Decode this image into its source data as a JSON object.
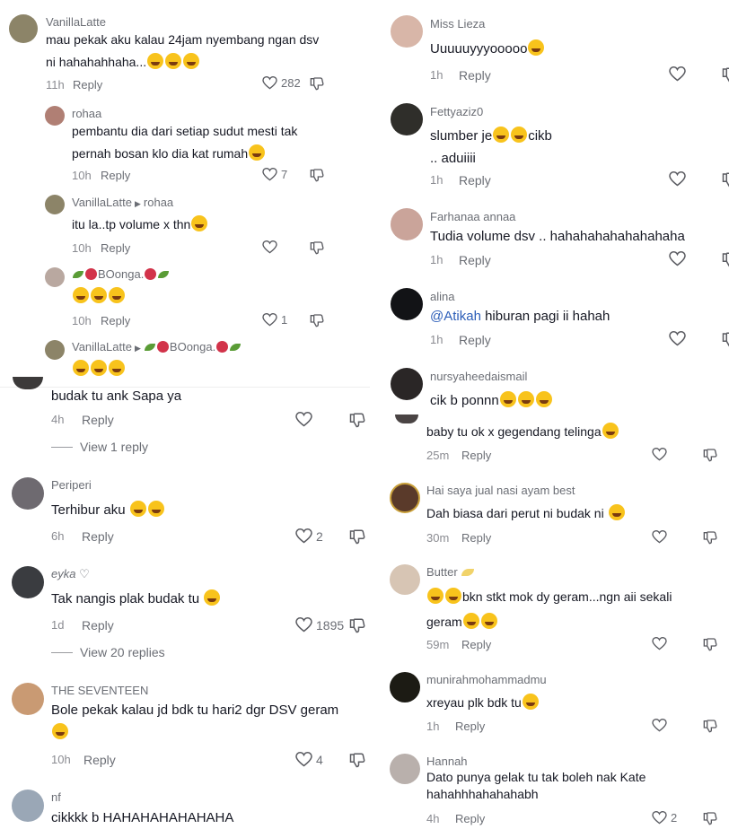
{
  "left": {
    "c1": {
      "name": "VanillaLatte",
      "line1": "mau pekak aku kalau 24jam nyembang ngan dsv",
      "line2": "ni hahahahhaha...",
      "time": "11h",
      "reply": "Reply",
      "likes": "282"
    },
    "c2": {
      "name": "rohaa",
      "line1": "pembantu dia dari setiap sudut mesti tak",
      "line2": "pernah bosan klo dia kat rumah",
      "time": "10h",
      "reply": "Reply",
      "likes": "7"
    },
    "c3": {
      "name": "VanillaLatte",
      "to": "rohaa",
      "line1": "itu la..tp volume x thn",
      "time": "10h",
      "reply": "Reply"
    },
    "c4": {
      "name": "BOonga.",
      "time": "10h",
      "reply": "Reply",
      "likes": "1"
    },
    "c5": {
      "name": "VanillaLatte",
      "to": "BOonga."
    },
    "c6": {
      "line1": "budak tu ank Sapa ya",
      "time": "4h",
      "reply": "Reply",
      "view": "View 1 reply"
    },
    "c7": {
      "name": "Periperi",
      "line1": "Terhibur aku",
      "time": "6h",
      "reply": "Reply",
      "likes": "2"
    },
    "c8": {
      "name": "eyka ♡",
      "line1": "Tak nangis plak budak tu",
      "time": "1d",
      "reply": "Reply",
      "likes": "1895",
      "view": "View 20 replies"
    },
    "c9": {
      "name": "THE SEVENTEEN",
      "line1": "Bole pekak kalau jd bdk tu hari2 dgr DSV geram",
      "time": "10h",
      "reply": "Reply",
      "likes": "4"
    },
    "c10": {
      "name": "nf",
      "line1": "cikkkk b HAHAHAHAHAHAHA"
    }
  },
  "right": {
    "r1": {
      "name": "Miss Lieza",
      "line1": "Uuuuuyyyooooo",
      "time": "1h",
      "reply": "Reply"
    },
    "r2": {
      "name": "Fettyaziz0",
      "line1": "slumber je",
      "line1b": "cikb",
      "line2": ".. aduiiii",
      "time": "1h",
      "reply": "Reply"
    },
    "r3": {
      "name": "Farhanaa annaa",
      "line1": "Tudia volume dsv .. hahahahahahahahaha",
      "time": "1h",
      "reply": "Reply"
    },
    "r4": {
      "name": "alina",
      "mention": "@Atikah",
      "line1": " hiburan pagi ii hahah",
      "time": "1h",
      "reply": "Reply"
    },
    "r5": {
      "name": "nursyaheedaismail",
      "line1": "cik b ponnn"
    },
    "r6": {
      "line1": "baby tu ok x gegendang telinga",
      "time": "25m",
      "reply": "Reply"
    },
    "r7": {
      "name": "Hai saya jual nasi ayam best",
      "line1": "Dah biasa dari perut ni budak ni",
      "time": "30m",
      "reply": "Reply"
    },
    "r8": {
      "name": "Butter",
      "line1": "bkn stkt mok dy geram...ngn aii sekali",
      "line2": "geram",
      "time": "59m",
      "reply": "Reply"
    },
    "r9": {
      "name": "munirahmohammadmu",
      "line1": "xreyau plk bdk tu",
      "time": "1h",
      "reply": "Reply"
    },
    "r10": {
      "name": "Hannah",
      "line1": "Dato punya gelak tu tak boleh nak Kate",
      "line2": "hahahhhahahahabh",
      "time": "4h",
      "reply": "Reply",
      "likes": "2"
    }
  }
}
